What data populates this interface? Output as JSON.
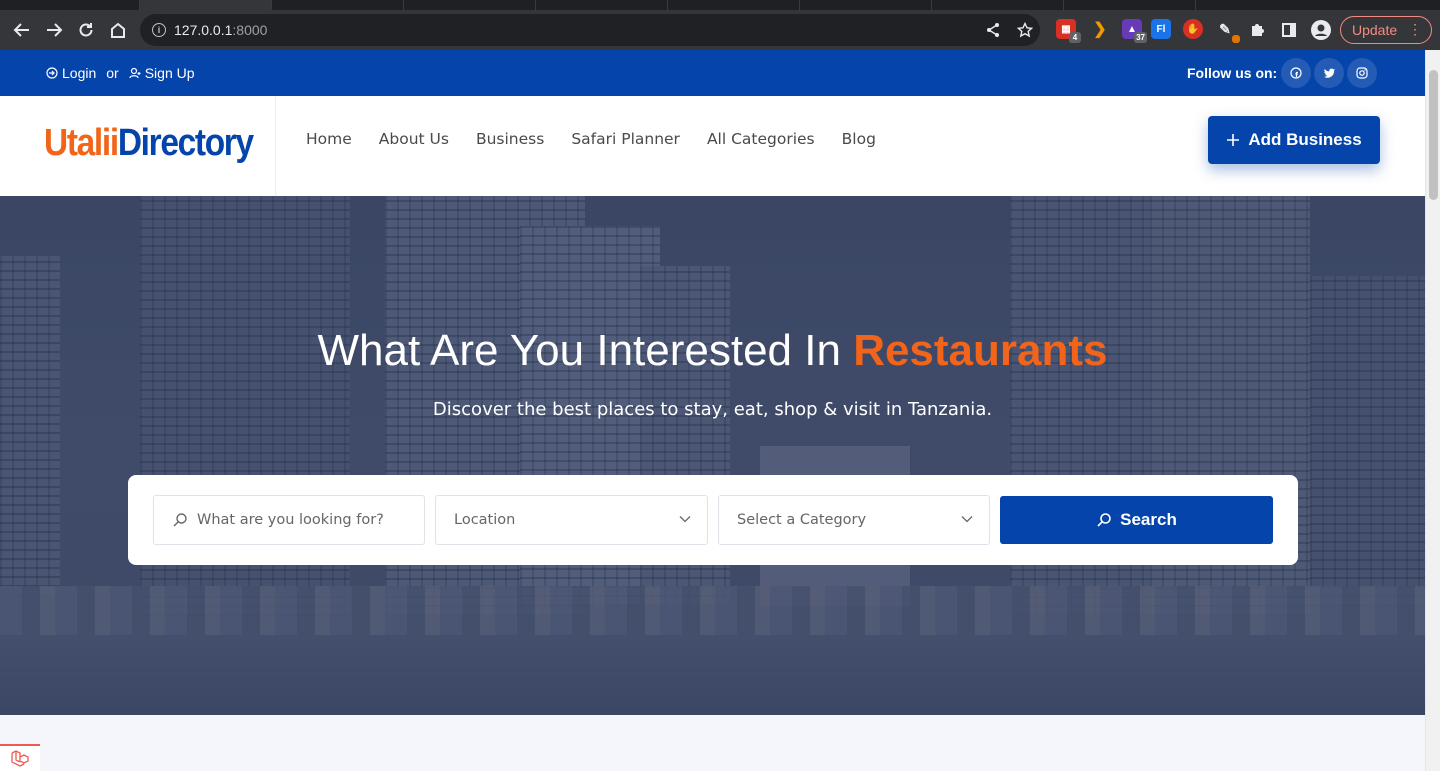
{
  "browser": {
    "url_host": "127.0.0.1",
    "url_port": ":8000",
    "update_label": "Update",
    "extensions": [
      {
        "name": "calendar-extension-icon",
        "badge": "4",
        "color": "#d93025"
      },
      {
        "name": "swirl-extension-icon",
        "badge": "",
        "color": "#f29900"
      },
      {
        "name": "hat-extension-icon",
        "badge": "37",
        "color": "#673ab7"
      },
      {
        "name": "ft-extension-icon",
        "badge": "",
        "color": "#1a73e8"
      },
      {
        "name": "hand-extension-icon",
        "badge": "",
        "color": "#d93025"
      },
      {
        "name": "pen-extension-icon",
        "badge": "",
        "color": "#e37400"
      }
    ]
  },
  "topbar": {
    "login_label": "Login",
    "or_label": "or",
    "signup_label": "Sign Up",
    "follow_label": "Follow us on:",
    "socials": [
      "facebook-icon",
      "twitter-icon",
      "instagram-icon"
    ]
  },
  "header": {
    "logo_part1": "Utalii",
    "logo_part2": "Directory",
    "nav": [
      "Home",
      "About Us",
      "Business",
      "Safari Planner",
      "All Categories",
      "Blog"
    ],
    "add_business_label": "Add Business"
  },
  "hero": {
    "title_prefix": "What Are You Interested In",
    "title_highlight": "Restaurants",
    "subtitle": "Discover the best places to stay, eat, shop & visit in Tanzania."
  },
  "search": {
    "keyword_placeholder": "What are you looking for?",
    "location_placeholder": "Location",
    "category_placeholder": "Select a Category",
    "button_label": "Search"
  },
  "colors": {
    "brand_blue": "#0545ab",
    "accent_orange": "#f2641a"
  }
}
